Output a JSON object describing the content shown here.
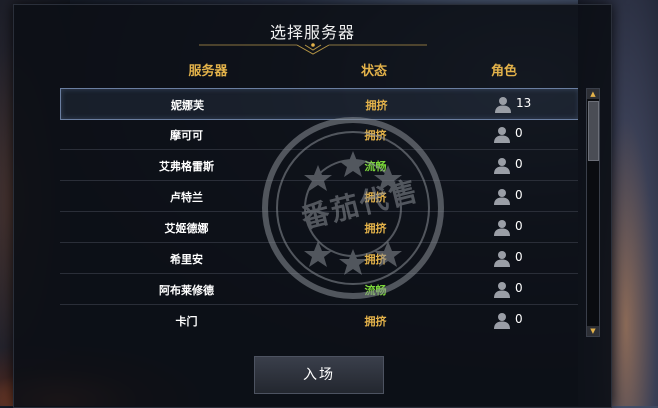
{
  "dialog": {
    "title": "选择服务器",
    "columns": {
      "server": "服务器",
      "status": "状态",
      "role": "角色"
    },
    "enter_label": "入场"
  },
  "servers": [
    {
      "name": "妮娜芙",
      "status": "拥挤",
      "roles": "13",
      "status_color": "#e3b24a"
    },
    {
      "name": "摩可可",
      "status": "拥挤",
      "roles": "0",
      "status_color": "#e3b24a"
    },
    {
      "name": "艾弗格雷斯",
      "status": "流畅",
      "roles": "0",
      "status_color": "#7cd63a"
    },
    {
      "name": "卢特兰",
      "status": "拥挤",
      "roles": "0",
      "status_color": "#e3b24a"
    },
    {
      "name": "艾姬德娜",
      "status": "拥挤",
      "roles": "0",
      "status_color": "#e3b24a"
    },
    {
      "name": "希里安",
      "status": "拥挤",
      "roles": "0",
      "status_color": "#e3b24a"
    },
    {
      "name": "阿布莱修德",
      "status": "流畅",
      "roles": "0",
      "status_color": "#7cd63a"
    },
    {
      "name": "卡门",
      "status": "拥挤",
      "roles": "0",
      "status_color": "#e3b24a"
    }
  ],
  "selected_index": 0,
  "scroll_position": 0,
  "watermark": {
    "text": "番茄代售"
  },
  "colors": {
    "accent": "#e3b24a",
    "smooth": "#7cd63a",
    "busy": "#e3b24a"
  }
}
